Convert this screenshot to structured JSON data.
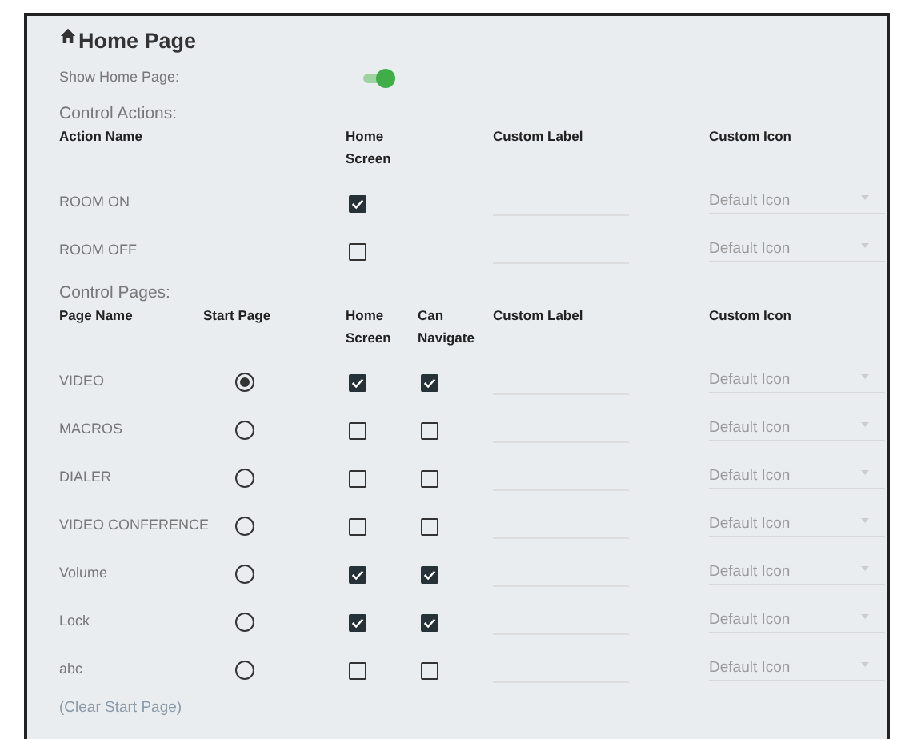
{
  "title": "Home Page",
  "show_home_page": {
    "label": "Show Home Page:",
    "on": true
  },
  "control_actions": {
    "heading": "Control Actions:",
    "columns": [
      "Action Name",
      "Home Screen",
      "Custom Label",
      "Custom Icon"
    ],
    "rows": [
      {
        "name": "ROOM ON",
        "home_screen": true,
        "custom_icon": "Default Icon"
      },
      {
        "name": "ROOM OFF",
        "home_screen": false,
        "custom_icon": "Default Icon"
      }
    ]
  },
  "control_pages": {
    "heading": "Control Pages:",
    "columns": [
      "Page Name",
      "Start Page",
      "Home Screen",
      "Can Navigate",
      "Custom Label",
      "Custom Icon"
    ],
    "rows": [
      {
        "name": "VIDEO",
        "selected": true,
        "home_screen": true,
        "can_navigate": true,
        "custom_icon": "Default Icon"
      },
      {
        "name": "MACROS",
        "selected": false,
        "home_screen": false,
        "can_navigate": false,
        "custom_icon": "Default Icon"
      },
      {
        "name": "DIALER",
        "selected": false,
        "home_screen": false,
        "can_navigate": false,
        "custom_icon": "Default Icon"
      },
      {
        "name": "VIDEO CONFERENCE",
        "selected": false,
        "home_screen": false,
        "can_navigate": false,
        "custom_icon": "Default Icon"
      },
      {
        "name": "Volume",
        "selected": false,
        "home_screen": true,
        "can_navigate": true,
        "custom_icon": "Default Icon"
      },
      {
        "name": "Lock",
        "selected": false,
        "home_screen": true,
        "can_navigate": true,
        "custom_icon": "Default Icon"
      },
      {
        "name": "abc",
        "selected": false,
        "home_screen": false,
        "can_navigate": false,
        "custom_icon": "Default Icon"
      }
    ]
  },
  "clear_link": "(Clear Start Page)"
}
